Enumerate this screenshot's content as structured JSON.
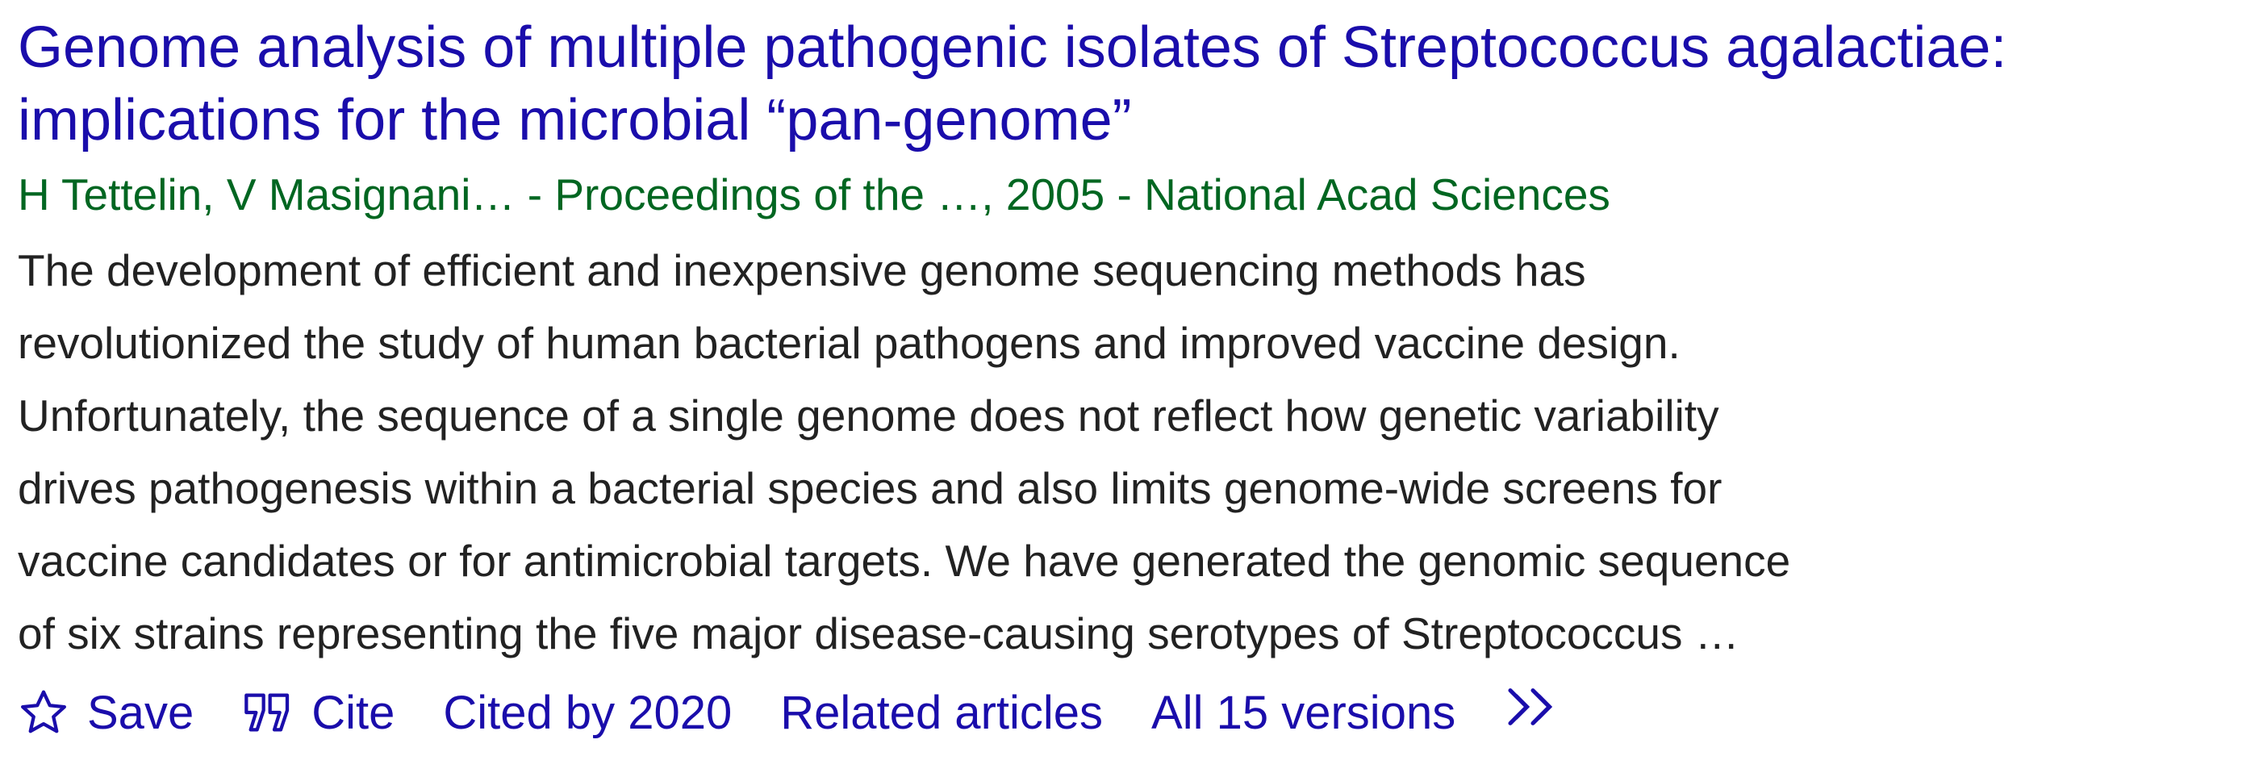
{
  "result": {
    "title_line1": "Genome analysis of multiple pathogenic isolates of Streptococcus agalactiae:",
    "title_line2": "implications for the microbial “pan-genome”",
    "meta": "H Tettelin, V Masignani… - Proceedings of the …, 2005 - National Acad Sciences",
    "snippet_lines": [
      "The development of efficient and inexpensive genome sequencing methods has",
      "revolutionized the study of human bacterial pathogens and improved vaccine design.",
      "Unfortunately, the sequence of a single genome does not reflect how genetic variability",
      "drives pathogenesis within a bacterial species and also limits genome-wide screens for",
      "vaccine candidates or for antimicrobial targets. We have generated the genomic sequence",
      "of six strains representing the five major disease-causing serotypes of Streptococcus …"
    ]
  },
  "actions": {
    "save_label": "Save",
    "save_icon": "star-outline-icon",
    "cite_label": "Cite",
    "cite_icon": "quote-icon",
    "cited_by_label": "Cited by 2020",
    "related_label": "Related articles",
    "versions_label": "All 15 versions",
    "more_icon": "double-chevron-right-icon"
  },
  "colors": {
    "link": "#1a0dab",
    "meta": "#006621",
    "text": "#222222"
  }
}
